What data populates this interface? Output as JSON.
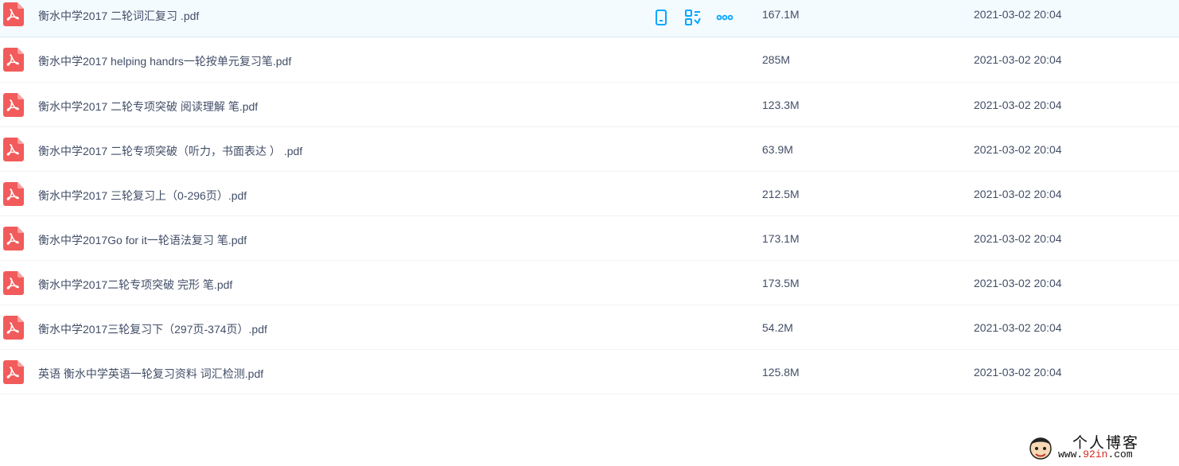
{
  "files": [
    {
      "name": "衡水中学2017 二轮词汇复习 .pdf",
      "size": "167.1M",
      "date": "2021-03-02 20:04"
    },
    {
      "name": "衡水中学2017 helping handrs一轮按单元复习笔.pdf",
      "size": "285M",
      "date": "2021-03-02 20:04"
    },
    {
      "name": "衡水中学2017 二轮专项突破 阅读理解 笔.pdf",
      "size": "123.3M",
      "date": "2021-03-02 20:04"
    },
    {
      "name": "衡水中学2017 二轮专项突破（听力，书面表达 ） .pdf",
      "size": "63.9M",
      "date": "2021-03-02 20:04"
    },
    {
      "name": "衡水中学2017 三轮复习上（0-296页）.pdf",
      "size": "212.5M",
      "date": "2021-03-02 20:04"
    },
    {
      "name": "衡水中学2017Go for it一轮语法复习 笔.pdf",
      "size": "173.1M",
      "date": "2021-03-02 20:04"
    },
    {
      "name": "衡水中学2017二轮专项突破 完形 笔.pdf",
      "size": "173.5M",
      "date": "2021-03-02 20:04"
    },
    {
      "name": "衡水中学2017三轮复习下（297页-374页）.pdf",
      "size": "54.2M",
      "date": "2021-03-02 20:04"
    },
    {
      "name": "英语 衡水中学英语一轮复习资料 词汇检测.pdf",
      "size": "125.8M",
      "date": "2021-03-02 20:04"
    }
  ],
  "watermark": {
    "title": "个人博客",
    "url_prefix": "www.",
    "url_highlight": "92in",
    "url_suffix": ".com"
  },
  "colors": {
    "pdf_icon": "#f25b5b",
    "action_icon": "#06a7ff",
    "row_hover": "#f4fbff"
  }
}
